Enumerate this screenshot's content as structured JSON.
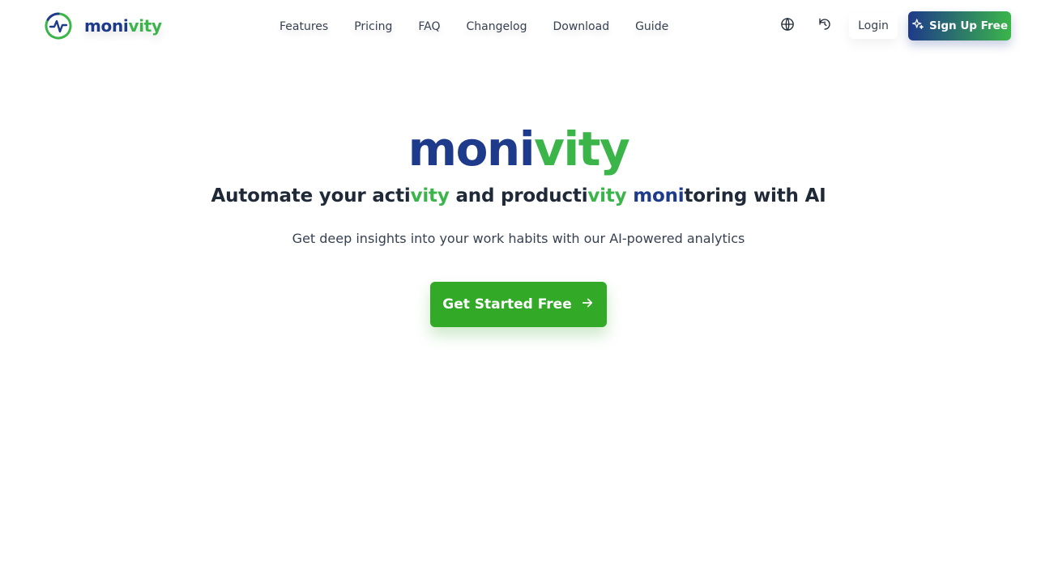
{
  "brand": {
    "name_part1": "moni",
    "name_part2": "vity",
    "logo_icon": "activity-pulse-icon"
  },
  "nav": {
    "items": [
      {
        "label": "Features"
      },
      {
        "label": "Pricing"
      },
      {
        "label": "FAQ"
      },
      {
        "label": "Changelog"
      },
      {
        "label": "Download"
      },
      {
        "label": "Guide"
      }
    ]
  },
  "header_actions": {
    "language_icon": "globe-icon",
    "history_icon": "history-icon",
    "login_label": "Login",
    "signup_label": "Sign Up Free",
    "signup_icon": "sparkles-icon"
  },
  "hero": {
    "title_part1": "moni",
    "title_part2": "vity",
    "tagline": {
      "p1": "Automate your acti",
      "p2": "vity",
      "p3": " and producti",
      "p4": "vity",
      "p5": " ",
      "p6": "moni",
      "p7": "toring with AI"
    },
    "subtitle": "Get deep insights into your work habits with our AI-powered analytics",
    "cta_label": "Get Started Free",
    "cta_icon": "arrow-right-icon"
  },
  "colors": {
    "brand_blue": "#1e3a8a",
    "brand_green": "#3bb54a",
    "cta_green": "#33a928"
  }
}
